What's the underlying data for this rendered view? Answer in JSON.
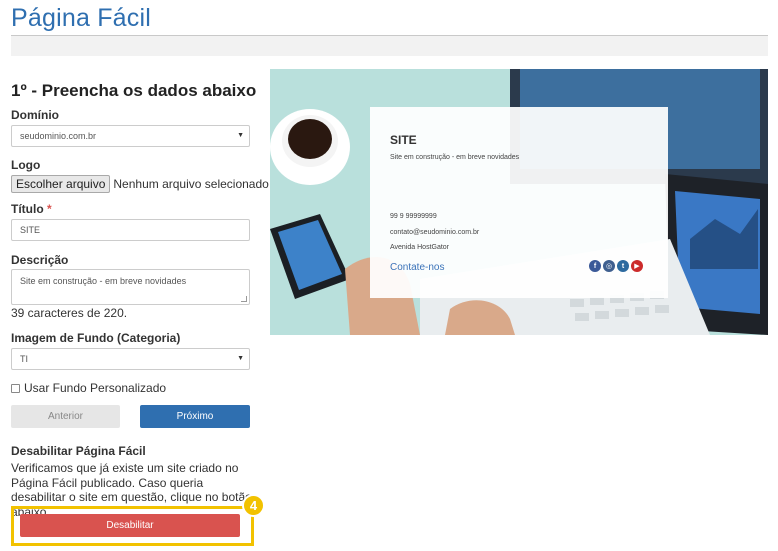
{
  "header": {
    "title": "Página Fácil"
  },
  "form": {
    "step_title": "1º - Preencha os dados abaixo",
    "domain_label": "Domínio",
    "domain_value": "seudominio.com.br",
    "logo_label": "Logo",
    "file_button": "Escolher arquivo",
    "file_status": "Nenhum arquivo selecionado",
    "title_label": "Título",
    "title_required": "*",
    "title_value": "SITE",
    "description_label": "Descrição",
    "description_value": "Site em construção - em breve novidades",
    "char_counter": "39 caracteres de 220.",
    "background_label": "Imagem de Fundo (Categoria)",
    "background_value": "TI",
    "custom_bg_label": "Usar Fundo Personalizado",
    "prev_button": "Anterior",
    "next_button": "Próximo"
  },
  "disable_section": {
    "title": "Desabilitar Página Fácil",
    "text": "Verificamos que já existe um site criado no Página Fácil publicado. Caso queria desabilitar o site em questão, clique no botão abaixo.",
    "button": "Desabilitar",
    "step_badge": "4"
  },
  "preview": {
    "site_title": "SITE",
    "description": "Site em construção - em breve novidades",
    "phone": "99 9 99999999",
    "email": "contato@seudominio.com.br",
    "address": "Avenida HostGator",
    "contact_link": "Contate-nos",
    "social_icons": [
      "facebook-icon",
      "instagram-icon",
      "twitter-icon",
      "youtube-icon"
    ]
  },
  "colors": {
    "primary": "#2f6fb0",
    "danger": "#d9534f",
    "highlight": "#f2c200"
  }
}
